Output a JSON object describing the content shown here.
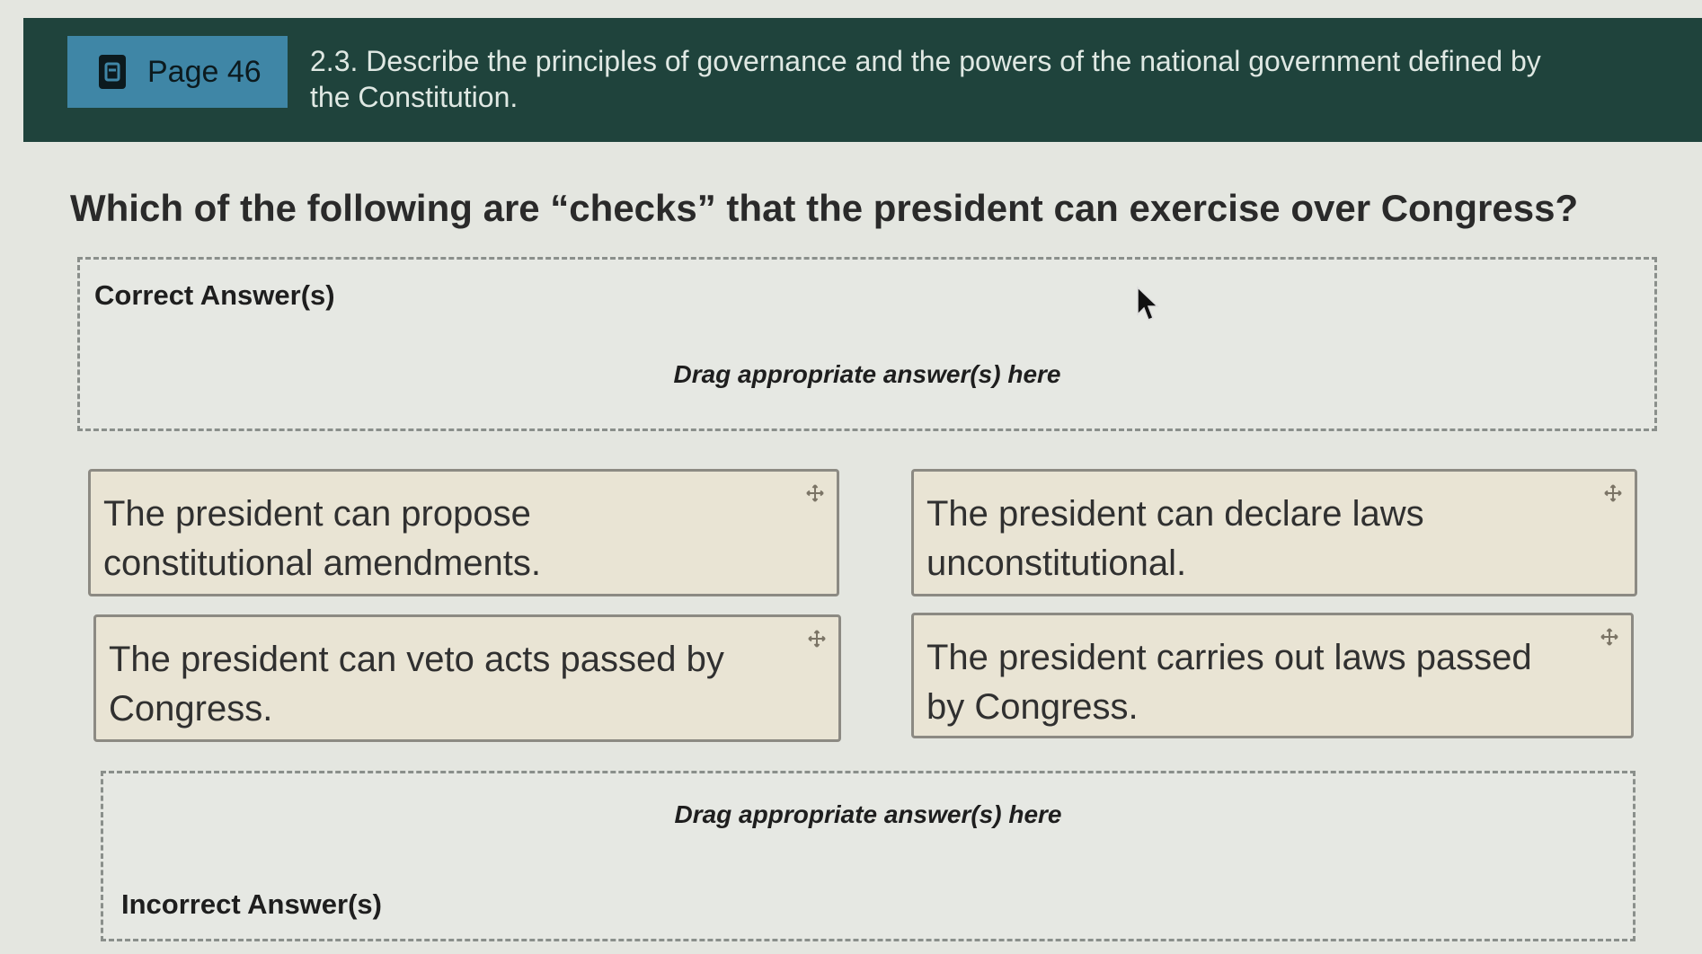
{
  "header": {
    "page_label": "Page 46",
    "objective": "2.3. Describe the principles of governance and the powers of the national government defined by the Constitution."
  },
  "question": "Which of the following are “checks” that the president can exercise over Congress?",
  "correct_zone": {
    "title": "Correct Answer(s)",
    "hint": "Drag appropriate answer(s) here"
  },
  "options": [
    {
      "text": "The president can propose constitutional amendments."
    },
    {
      "text": "The president can declare laws unconstitutional."
    },
    {
      "text": "The president can veto acts passed by Congress."
    },
    {
      "text": "The president carries out laws passed by Congress."
    }
  ],
  "incorrect_zone": {
    "hint": "Drag appropriate answer(s) here",
    "title": "Incorrect Answer(s)"
  },
  "icons": {
    "page": "book-icon",
    "drag": "move-icon",
    "pointer": "cursor-icon"
  },
  "colors": {
    "header_bg": "#1f433c",
    "badge_bg": "#3f86a6",
    "card_bg": "#e9e4d4"
  }
}
